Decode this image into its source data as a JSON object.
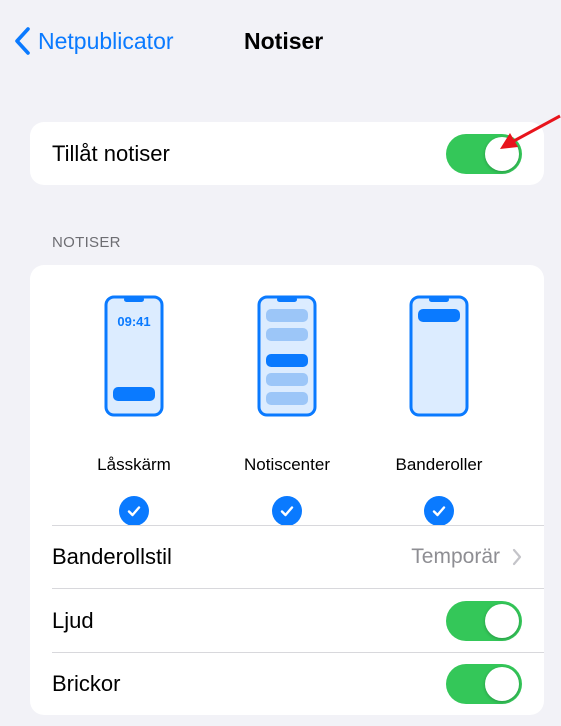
{
  "nav": {
    "back_label": "Netpublicator",
    "title": "Notiser"
  },
  "allow": {
    "label": "Tillåt notiser",
    "on": true
  },
  "section": {
    "header": "NOTISER"
  },
  "styles": [
    {
      "label": "Låsskärm",
      "checked": true,
      "icon": "lock-screen-phone-icon",
      "clock": "09:41"
    },
    {
      "label": "Notiscenter",
      "checked": true,
      "icon": "notification-center-phone-icon"
    },
    {
      "label": "Banderoller",
      "checked": true,
      "icon": "banners-phone-icon"
    }
  ],
  "banner_style": {
    "label": "Banderollstil",
    "value": "Temporär"
  },
  "sound": {
    "label": "Ljud",
    "on": true
  },
  "badges": {
    "label": "Brickor",
    "on": true
  },
  "colors": {
    "accent": "#0a7aff",
    "toggle_on": "#34c759",
    "annotation_arrow": "#e8141c"
  }
}
